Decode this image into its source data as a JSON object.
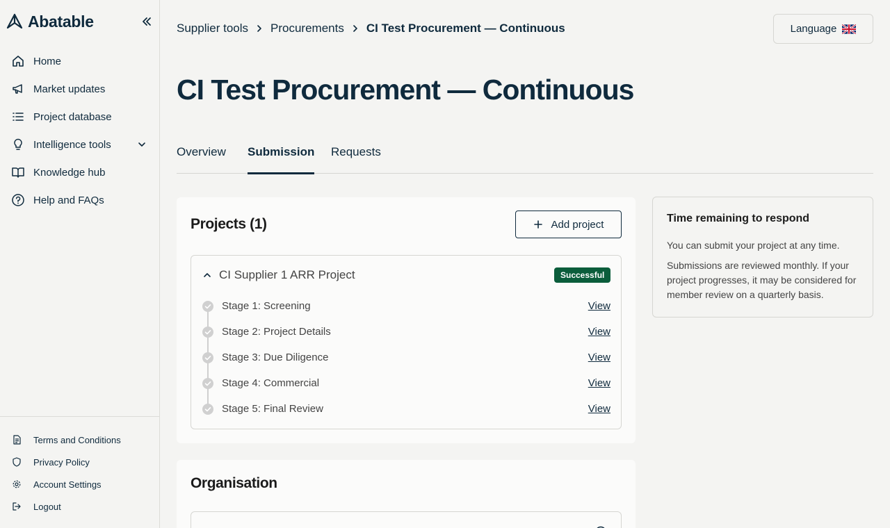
{
  "app": {
    "brand": "Abatable"
  },
  "sidebar": {
    "items": [
      {
        "label": "Home",
        "icon": "home-icon"
      },
      {
        "label": "Market updates",
        "icon": "megaphone-icon"
      },
      {
        "label": "Project database",
        "icon": "list-icon"
      },
      {
        "label": "Intelligence tools",
        "icon": "lightbulb-icon",
        "expandable": true
      },
      {
        "label": "Knowledge hub",
        "icon": "book-icon"
      },
      {
        "label": "Help and FAQs",
        "icon": "help-icon"
      }
    ],
    "footer": [
      {
        "label": "Terms and Conditions",
        "icon": "document-icon"
      },
      {
        "label": "Privacy Policy",
        "icon": "shield-icon"
      },
      {
        "label": "Account Settings",
        "icon": "gear-icon"
      },
      {
        "label": "Logout",
        "icon": "logout-icon"
      }
    ]
  },
  "breadcrumb": {
    "items": [
      "Supplier tools",
      "Procurements",
      "CI Test Procurement — Continuous"
    ]
  },
  "language": {
    "label": "Language",
    "flag": "uk-flag-icon"
  },
  "page": {
    "title": "CI Test Procurement — Continuous"
  },
  "tabs": [
    {
      "label": "Overview",
      "active": false
    },
    {
      "label": "Submission",
      "active": true
    },
    {
      "label": "Requests",
      "active": false
    }
  ],
  "projects": {
    "title": "Projects (1)",
    "add_label": "Add project",
    "project": {
      "name": "CI Supplier 1 ARR Project",
      "status": "Successful",
      "stages": [
        {
          "label": "Stage 1: Screening",
          "action": "View"
        },
        {
          "label": "Stage 2: Project Details",
          "action": "View"
        },
        {
          "label": "Stage 3: Due Diligence",
          "action": "View"
        },
        {
          "label": "Stage 4: Commercial",
          "action": "View"
        },
        {
          "label": "Stage 5: Final Review",
          "action": "View"
        }
      ]
    }
  },
  "time_remaining": {
    "title": "Time remaining to respond",
    "p1": "You can submit your project at any time.",
    "p2": "Submissions are reviewed monthly. If your project progresses, it may be considered for member review on a quarterly basis."
  },
  "organisation": {
    "title": "Organisation"
  },
  "colors": {
    "primary": "#0f2a3d",
    "success": "#0b5d3b",
    "background": "#f4f4f2",
    "card": "#fbfbfa"
  }
}
